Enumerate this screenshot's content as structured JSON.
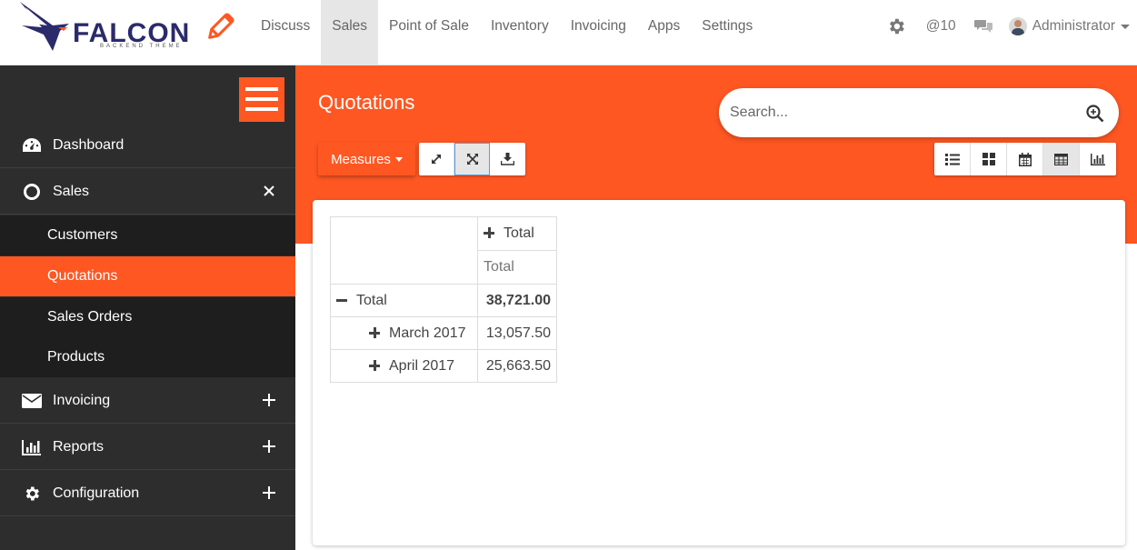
{
  "brand": {
    "name": "FALCON",
    "tagline": "Backend Theme"
  },
  "top_menu": [
    {
      "label": "Discuss",
      "active": false
    },
    {
      "label": "Sales",
      "active": true
    },
    {
      "label": "Point of Sale",
      "active": false
    },
    {
      "label": "Inventory",
      "active": false
    },
    {
      "label": "Invoicing",
      "active": false
    },
    {
      "label": "Apps",
      "active": false
    },
    {
      "label": "Settings",
      "active": false
    }
  ],
  "top_right": {
    "mentions_label": "@10",
    "user_name": "Administrator"
  },
  "sidebar": {
    "items": [
      {
        "label": "Dashboard",
        "icon": "dashboard-icon"
      },
      {
        "label": "Sales",
        "icon": "circle-icon",
        "expanded": true
      },
      {
        "label": "Invoicing",
        "icon": "envelope-icon"
      },
      {
        "label": "Reports",
        "icon": "bar-chart-icon"
      },
      {
        "label": "Configuration",
        "icon": "gear-icon"
      }
    ],
    "sales_subitems": [
      {
        "label": "Customers",
        "active": false
      },
      {
        "label": "Quotations",
        "active": true
      },
      {
        "label": "Sales Orders",
        "active": false
      },
      {
        "label": "Products",
        "active": false
      }
    ]
  },
  "page": {
    "title": "Quotations",
    "search_placeholder": "Search...",
    "measures_label": "Measures"
  },
  "pivot": {
    "col_header": "Total",
    "col_subheader": "Total",
    "row_total_label": "Total",
    "total_value": "38,721.00",
    "rows": [
      {
        "label": "March 2017",
        "value": "13,057.50"
      },
      {
        "label": "April 2017",
        "value": "25,663.50"
      }
    ]
  },
  "colors": {
    "accent": "#ff5722",
    "sidebar_bg": "#2d2d2d",
    "submenu_bg": "#1e1e1e",
    "brand_purple": "#2b2a6b"
  }
}
